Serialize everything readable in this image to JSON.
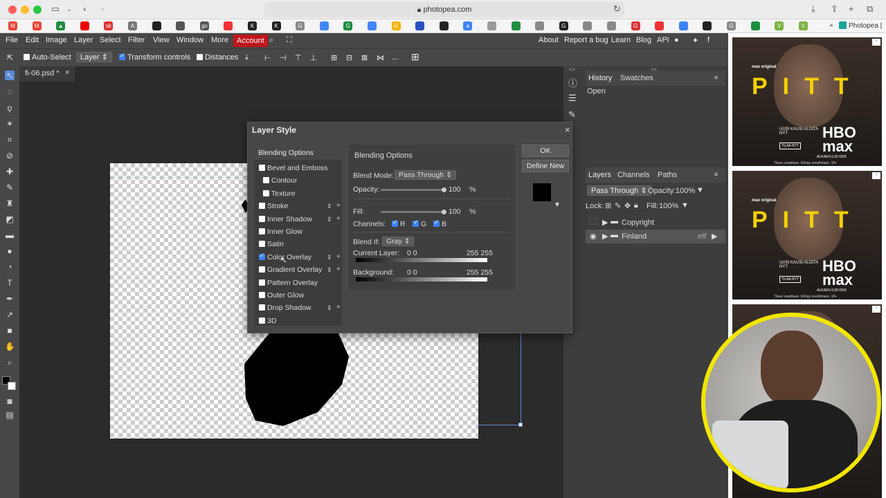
{
  "browser": {
    "url": "photopea.com",
    "bookmark_tab": "Photopea | ...",
    "bookmark_letters": [
      "M",
      "M",
      "▲",
      "",
      "sk",
      "A",
      "",
      "",
      "go",
      "",
      "K",
      "K",
      "G",
      "",
      "G",
      "",
      "G",
      "",
      "",
      "a",
      "",
      "",
      "",
      "G",
      "",
      "",
      "G",
      "",
      "",
      "",
      "G",
      "",
      "V",
      "V"
    ]
  },
  "menu": {
    "items": [
      "File",
      "Edit",
      "Image",
      "Layer",
      "Select",
      "Filter",
      "View",
      "Window",
      "More"
    ],
    "account": "Account",
    "right_items": [
      "About",
      "Report a bug",
      "Learn",
      "Blog",
      "API"
    ]
  },
  "options": {
    "auto_select": "Auto-Select",
    "layer_select": "Layer",
    "transform_controls": "Transform controls",
    "distances": "Distances",
    "more": "..."
  },
  "document": {
    "tab": "fi-06.psd *"
  },
  "history": {
    "tabs": [
      "History",
      "Swatches"
    ],
    "items": [
      "Open"
    ]
  },
  "layers": {
    "tabs": [
      "Layers",
      "Channels",
      "Paths"
    ],
    "blend_mode": "Pass Through",
    "opacity_label": "Opacity:",
    "opacity": "100%",
    "lock_label": "Lock:",
    "fill_label": "Fill:",
    "fill": "100%",
    "rows": [
      {
        "name": "Copyright",
        "visible": false
      },
      {
        "name": "Finland",
        "visible": true,
        "badge": "eff"
      }
    ]
  },
  "dialog": {
    "title": "Layer Style",
    "list_header": "Blending Options",
    "styles": [
      {
        "label": "Bevel and Emboss",
        "checked": false,
        "extras": false
      },
      {
        "label": "Contour",
        "checked": false,
        "extras": false
      },
      {
        "label": "Texture",
        "checked": false,
        "extras": false
      },
      {
        "label": "Stroke",
        "checked": false,
        "extras": true
      },
      {
        "label": "Inner Shadow",
        "checked": false,
        "extras": true
      },
      {
        "label": "Inner Glow",
        "checked": false,
        "extras": false
      },
      {
        "label": "Satin",
        "checked": false,
        "extras": false
      },
      {
        "label": "Color Overlay",
        "checked": true,
        "extras": true
      },
      {
        "label": "Gradient Overlay",
        "checked": false,
        "extras": true
      },
      {
        "label": "Pattern Overlay",
        "checked": false,
        "extras": false
      },
      {
        "label": "Outer Glow",
        "checked": false,
        "extras": false
      },
      {
        "label": "Drop Shadow",
        "checked": false,
        "extras": true
      },
      {
        "label": "3D",
        "checked": false,
        "extras": false
      }
    ],
    "panel_title": "Blending Options",
    "blend_mode_label": "Blend Mode:",
    "blend_mode": "Pass Through",
    "opacity_label": "Opacity:",
    "opacity": "100",
    "fill_label": "Fill:",
    "fill": "100",
    "percent": "%",
    "channels_label": "Channels:",
    "channels": [
      "R",
      "G",
      "B"
    ],
    "blend_if_label": "Blend If:",
    "blend_if": "Gray",
    "current_layer_label": "Current Layer:",
    "current_layer_values": "0    0",
    "current_layer_values_right": "255 255",
    "background_label": "Background:",
    "background_values": "0    0",
    "background_values_right": "255 255",
    "ok": "OK",
    "define_new": "Define New",
    "close": "×"
  },
  "ads": {
    "brand": "max original",
    "title": "THE PITT",
    "pitt": "PITT",
    "line1": "UUSI KAUSI ALOITA NYT",
    "cta": "TILAA NYT",
    "hbo": "HBO",
    "max": "max",
    "price": "ALKAEN 6,99 €/KK",
    "terms": "Tilaus vaaditaan. Ehtoja sovelletaan. 18+"
  },
  "colors": {
    "accent_red": "#c0151a",
    "check_blue": "#3b82f6",
    "webcam_ring": "#f2e600",
    "ad_yellow": "#f5d000"
  }
}
